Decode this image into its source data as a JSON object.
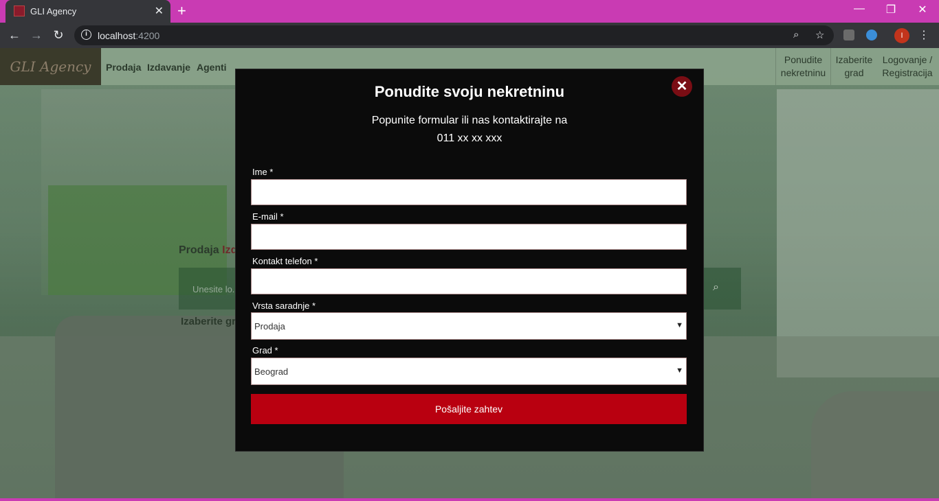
{
  "browser": {
    "tab_title": "GLI Agency",
    "tab_close": "✕",
    "new_tab": "+",
    "url_host": "localhost",
    "url_port": ":4200",
    "profile_initial": "I",
    "window_minimize": "—",
    "window_restore": "❐",
    "window_close": "✕"
  },
  "navbar": {
    "brand": "GLI Agency",
    "links": [
      "Prodaja",
      "Izdavanje",
      "Agenti"
    ],
    "right_links": [
      {
        "line1": "Ponudite",
        "line2": "nekretninu"
      },
      {
        "line1": "Izaberite",
        "line2": "grad"
      },
      {
        "line1": "Logovanje /",
        "line2": "Registracija"
      }
    ]
  },
  "background": {
    "tabs": [
      "Prodaja",
      "Izdavanje"
    ],
    "search_placeholder": "Unesite lo...",
    "city_label": "Izaberite grad"
  },
  "modal": {
    "title": "Ponudite svoju nekretninu",
    "subtitle_line1": "Popunite formular ili nas kontaktirajte na",
    "subtitle_line2": "011 xx xx xxx",
    "close_icon": "✕",
    "fields": {
      "name_label": "Ime *",
      "email_label": "E-mail *",
      "phone_label": "Kontakt telefon *",
      "type_label": "Vrsta saradnje *",
      "type_value": "Prodaja",
      "city_label": "Grad *",
      "city_value": "Beograd"
    },
    "submit_label": "Pošaljite zahtev"
  },
  "colors": {
    "accent_red": "#b90010",
    "close_red": "#7a0d14",
    "titlebar": "#c93bb3"
  }
}
